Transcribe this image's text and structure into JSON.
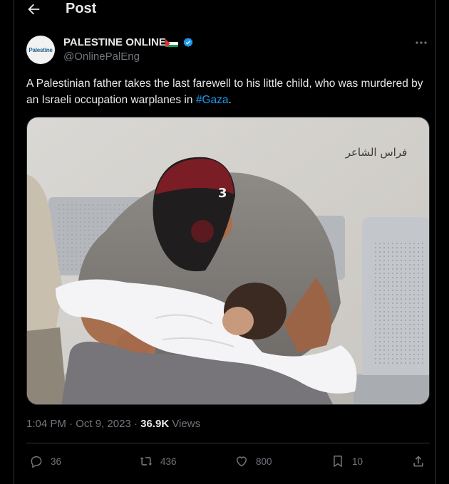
{
  "header": {
    "title": "Post"
  },
  "author": {
    "avatar_text": "Palestine",
    "name": "PALESTINE ONLINE",
    "handle": "@OnlinePalEng",
    "verified": true
  },
  "tweet": {
    "text_before": "A Palestinian father takes the last farewell to his little child, who was murdered by an Israeli occupation warplanes in ",
    "hashtag": "#Gaza",
    "text_after": "."
  },
  "media": {
    "watermark": "فراس الشاعر",
    "cap_number": "3"
  },
  "meta": {
    "time": "1:04 PM",
    "separator": " · ",
    "date": "Oct 9, 2023",
    "views_count": "36.9K",
    "views_label": " Views"
  },
  "actions": {
    "replies": "36",
    "reposts": "436",
    "likes": "800",
    "bookmarks": "10"
  },
  "colors": {
    "accent": "#1d9bf0",
    "text": "#e7e9ea",
    "muted": "#71767b",
    "border": "#2f3336"
  }
}
